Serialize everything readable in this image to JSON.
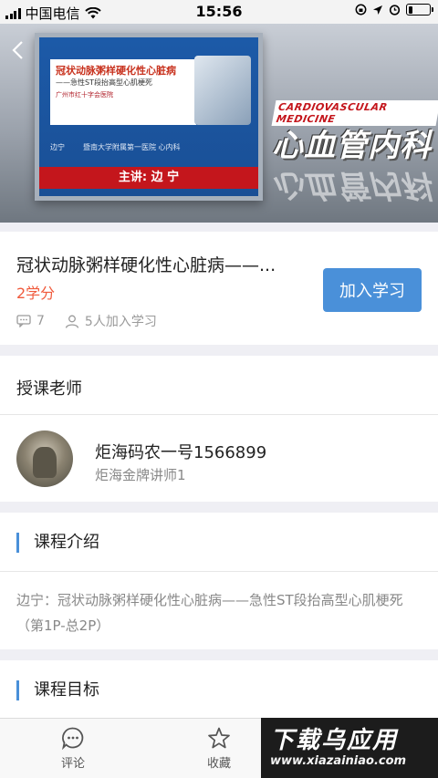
{
  "status_bar": {
    "carrier": "中国电信",
    "time": "15:56",
    "battery_level": 0.2
  },
  "hero": {
    "slide_title": "冠状动脉粥样硬化性心脏病",
    "slide_subtitle": "——急性ST段抬高型心肌梗死",
    "slide_logo": "广州市红十字会医院",
    "speaker_short": "边宁",
    "hospital_short": "暨南大学附属第一医院 心内科",
    "presenter": "主讲: 边 宁",
    "department_en": "CARDIOVASCULAR MEDICINE",
    "department_cn": "心血管内科"
  },
  "course": {
    "title": "冠状动脉粥样硬化性心脏病——...",
    "credits": "2学分",
    "comment_count": "7",
    "joined": "5人加入学习",
    "join_button": "加入学习"
  },
  "teacher": {
    "section_title": "授课老师",
    "name": "炬海码农一号1566899",
    "title": "炬海金牌讲师1"
  },
  "intro": {
    "section_title": "课程介绍",
    "text": "边宁：冠状动脉粥样硬化性心脏病——急性ST段抬高型心肌梗死（第1P-总2P）"
  },
  "goals": {
    "section_title": "课程目标"
  },
  "tabbar": {
    "comment_label": "评论",
    "favorite_label": "收藏"
  },
  "watermark": {
    "main": "下载乌应用",
    "url": "www.xiazainiao.com"
  },
  "colors": {
    "accent": "#4a90d9",
    "credit": "#f05a3c",
    "presenter_bar": "#c4161c"
  }
}
